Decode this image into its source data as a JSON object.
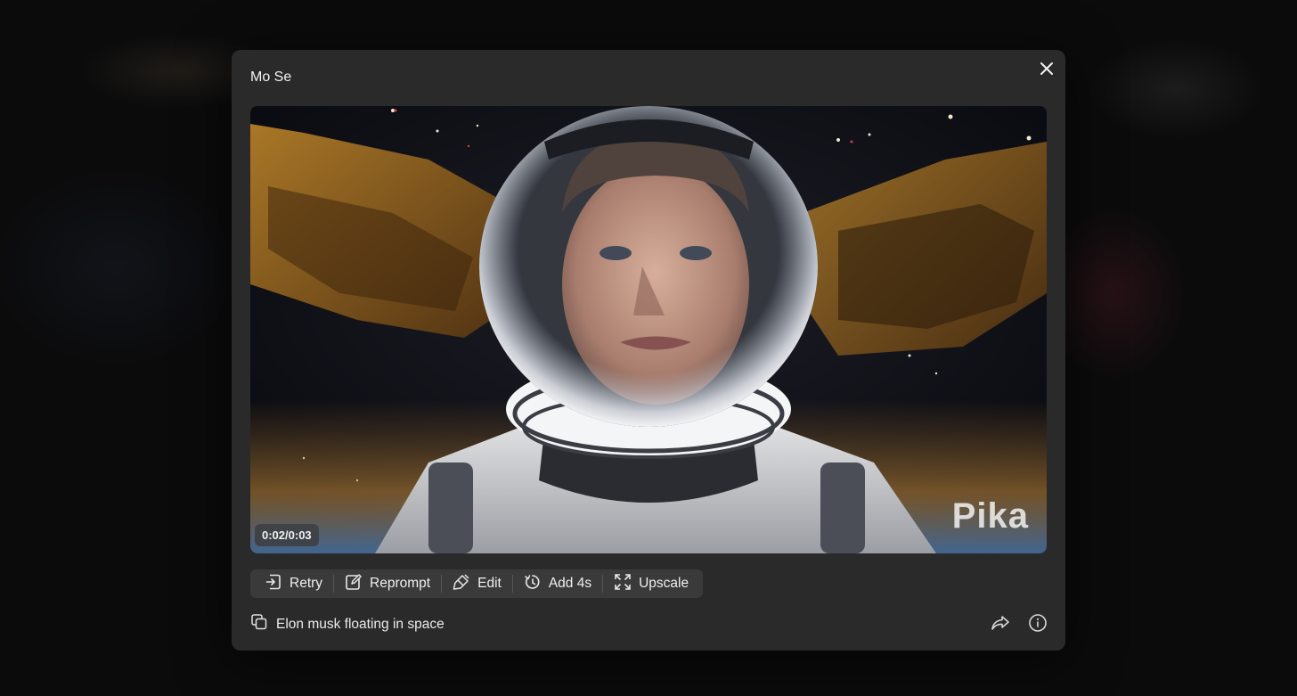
{
  "modal": {
    "title": "Mo Se",
    "close_icon": "close-icon"
  },
  "video": {
    "timestamp": "0:02/0:03",
    "watermark": "Pika"
  },
  "toolbar": {
    "items": [
      {
        "label": "Retry",
        "icon": "retry-icon"
      },
      {
        "label": "Reprompt",
        "icon": "edit-pencil-icon"
      },
      {
        "label": "Edit",
        "icon": "brush-icon"
      },
      {
        "label": "Add 4s",
        "icon": "timer-icon"
      },
      {
        "label": "Upscale",
        "icon": "expand-icon"
      }
    ]
  },
  "prompt": {
    "text": "Elon musk floating in space",
    "icon": "copy-icon"
  },
  "actions": {
    "share_icon": "share-icon",
    "info_icon": "info-icon"
  }
}
